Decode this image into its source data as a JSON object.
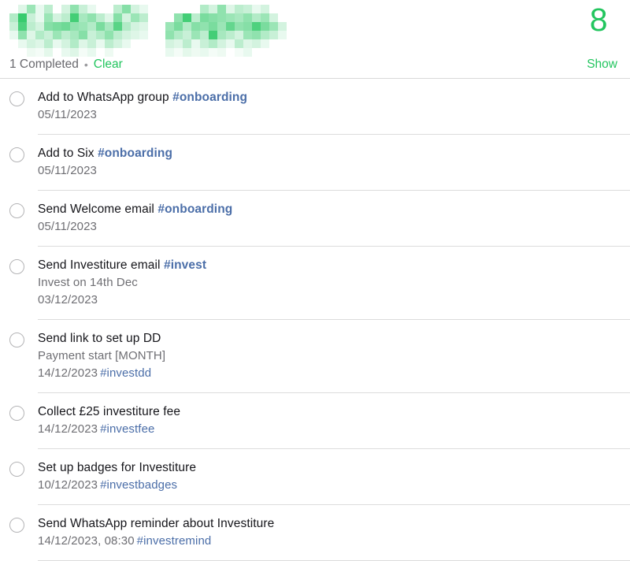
{
  "header": {
    "title_redacted": true,
    "title_redaction_note": "list title obscured by green pixelation mosaic",
    "count": "8",
    "count_color": "#22c55e",
    "completed_label": "1 Completed",
    "separator": "•",
    "clear_label": "Clear",
    "show_label": "Show",
    "link_color": "#22c55e",
    "redaction_color": "#22c55e"
  },
  "list": {
    "tag_color": "#4b6ea8",
    "items": [
      {
        "checkbox": "unchecked",
        "title": "Add to WhatsApp group",
        "title_tag": "#onboarding",
        "note": "",
        "date": "05/11/2023",
        "date_tag": ""
      },
      {
        "checkbox": "unchecked",
        "title": "Add to Six",
        "title_tag": "#onboarding",
        "note": "",
        "date": "05/11/2023",
        "date_tag": ""
      },
      {
        "checkbox": "unchecked",
        "title": "Send Welcome email",
        "title_tag": "#onboarding",
        "note": "",
        "date": "05/11/2023",
        "date_tag": ""
      },
      {
        "checkbox": "unchecked",
        "title": "Send Investiture email",
        "title_tag": "#invest",
        "note": "Invest on 14th Dec",
        "date": "03/12/2023",
        "date_tag": ""
      },
      {
        "checkbox": "unchecked",
        "title": "Send link to set up DD",
        "title_tag": "",
        "note": "Payment start [MONTH]",
        "date": "14/12/2023",
        "date_tag": "#investdd"
      },
      {
        "checkbox": "unchecked",
        "title": "Collect £25 investiture fee",
        "title_tag": "",
        "note": "",
        "date": "14/12/2023",
        "date_tag": "#investfee"
      },
      {
        "checkbox": "unchecked",
        "title": "Set up badges for Investiture",
        "title_tag": "",
        "note": "",
        "date": "10/12/2023",
        "date_tag": "#investbadges"
      },
      {
        "checkbox": "unchecked",
        "title": "Send WhatsApp reminder about Investiture",
        "title_tag": "",
        "note": "",
        "date": "14/12/2023, 08:30",
        "date_tag": "#investremind"
      }
    ]
  },
  "redaction_mosaic": {
    "cell": 11,
    "rows": [
      [
        0,
        0.15,
        0.45,
        0.1,
        0.3,
        0,
        0.2,
        0.5,
        0.25,
        0.1,
        0,
        0,
        0.3,
        0.55,
        0.2,
        0.1,
        0,
        0,
        0,
        0,
        0,
        0,
        0.35,
        0.2,
        0.5,
        0.15,
        0.3,
        0.25,
        0.1,
        0.2,
        0,
        0
      ],
      [
        0.35,
        0.9,
        0.25,
        0.1,
        0.45,
        0.2,
        0.3,
        0.85,
        0.4,
        0.5,
        0.3,
        0.15,
        0.55,
        0.2,
        0.45,
        0.3,
        0,
        0,
        0,
        0.5,
        0.85,
        0.3,
        0.6,
        0.55,
        0.5,
        0.45,
        0.4,
        0.5,
        0.35,
        0.45,
        0.2,
        0
      ],
      [
        0.25,
        0.8,
        0.3,
        0.2,
        0.55,
        0.6,
        0.65,
        0.5,
        0.45,
        0.35,
        0.6,
        0.4,
        0.75,
        0.35,
        0.2,
        0.15,
        0,
        0,
        0.45,
        0.6,
        0.35,
        0.55,
        0.5,
        0.6,
        0.45,
        0.7,
        0.5,
        0.55,
        0.8,
        0.6,
        0.45,
        0.2
      ],
      [
        0.1,
        0.5,
        0.15,
        0.35,
        0.25,
        0.45,
        0.3,
        0.4,
        0.55,
        0.25,
        0.35,
        0.5,
        0.3,
        0.2,
        0.15,
        0.1,
        0,
        0,
        0.5,
        0.35,
        0.25,
        0.45,
        0.3,
        0.85,
        0.4,
        0.3,
        0.2,
        0.45,
        0.5,
        0.35,
        0.25,
        0.1
      ],
      [
        0,
        0.1,
        0.2,
        0.15,
        0.3,
        0.1,
        0.2,
        0.35,
        0.15,
        0.25,
        0.1,
        0.3,
        0.2,
        0.1,
        0,
        0,
        0,
        0,
        0.2,
        0.15,
        0.3,
        0.1,
        0.25,
        0.35,
        0.2,
        0.1,
        0.3,
        0.15,
        0.2,
        0.1,
        0,
        0
      ],
      [
        0,
        0,
        0.08,
        0.05,
        0.12,
        0,
        0.1,
        0.15,
        0.05,
        0.1,
        0,
        0.08,
        0,
        0,
        0,
        0,
        0,
        0,
        0.1,
        0.05,
        0.12,
        0.08,
        0.1,
        0.05,
        0.08,
        0,
        0.05,
        0.1,
        0,
        0,
        0,
        0
      ]
    ]
  }
}
